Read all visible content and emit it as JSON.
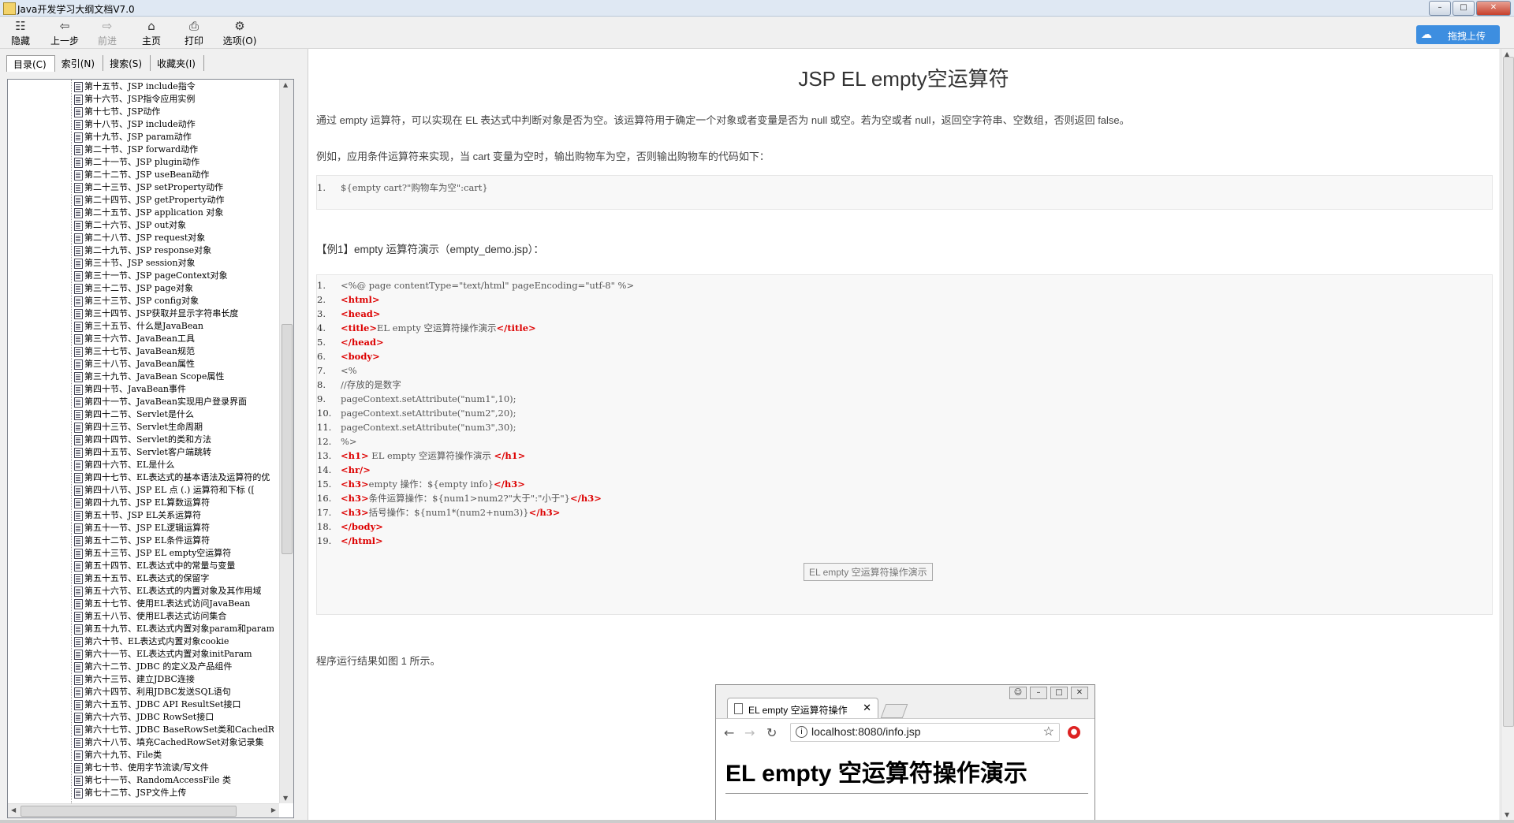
{
  "window": {
    "title": "Java开发学习大纲文档V7.0"
  },
  "toolbar": {
    "hide": "隐藏",
    "back": "上一步",
    "forward": "前进",
    "home": "主页",
    "print": "打印",
    "options": "选项(O)",
    "upload": "拖拽上传"
  },
  "tabs": [
    "目录(C)",
    "索引(N)",
    "搜索(S)",
    "收藏夹(I)"
  ],
  "tree": [
    "第十五节、JSP include指令",
    "第十六节、JSP指令应用实例",
    "第十七节、JSP动作",
    "第十八节、JSP include动作",
    "第十九节、JSP param动作",
    "第二十节、JSP forward动作",
    "第二十一节、JSP plugin动作",
    "第二十二节、JSP useBean动作",
    "第二十三节、JSP setProperty动作",
    "第二十四节、JSP getProperty动作",
    "第二十五节、JSP application 对象",
    "第二十六节、JSP out对象",
    "第二十八节、JSP request对象",
    "第二十九节、JSP response对象",
    "第三十节、JSP session对象",
    "第三十一节、JSP pageContext对象",
    "第三十二节、JSP page对象",
    "第三十三节、JSP config对象",
    "第三十四节、JSP获取并显示字符串长度",
    "第三十五节、什么是JavaBean",
    "第三十六节、JavaBean工具",
    "第三十七节、JavaBean规范",
    "第三十八节、JavaBean属性",
    "第三十九节、JavaBean Scope属性",
    "第四十节、JavaBean事件",
    "第四十一节、JavaBean实现用户登录界面",
    "第四十二节、Servlet是什么",
    "第四十三节、Servlet生命周期",
    "第四十四节、Servlet的类和方法",
    "第四十五节、Servlet客户端跳转",
    "第四十六节、EL是什么",
    "第四十七节、EL表达式的基本语法及运算符的优",
    "第四十八节、JSP EL 点 (.) 运算符和下标 ([",
    "第四十九节、JSP EL算数运算符",
    "第五十节、JSP EL关系运算符",
    "第五十一节、JSP EL逻辑运算符",
    "第五十二节、JSP EL条件运算符",
    "第五十三节、JSP EL empty空运算符",
    "第五十四节、EL表达式中的常量与变量",
    "第五十五节、EL表达式的保留字",
    "第五十六节、EL表达式的内置对象及其作用域",
    "第五十七节、使用EL表达式访问JavaBean",
    "第五十八节、使用EL表达式访问集合",
    "第五十九节、EL表达式内置对象param和paramV",
    "第六十节、EL表达式内置对象cookie",
    "第六十一节、EL表达式内置对象initParam",
    "第六十二节、JDBC 的定义及产品组件",
    "第六十三节、建立JDBC连接",
    "第六十四节、利用JDBC发送SQL语句",
    "第六十五节、JDBC API ResultSet接口",
    "第六十六节、JDBC RowSet接口",
    "第六十七节、JDBC BaseRowSet类和CachedRowS",
    "第六十八节、填充CachedRowSet对象记录集",
    "第六十九节、File类",
    "第七十节、使用字节流读/写文件",
    "第七十一节、RandomAccessFile 类",
    "第七十二节、JSP文件上传"
  ],
  "content": {
    "title": "JSP EL empty空运算符",
    "p1": "通过 empty 运算符，可以实现在 EL 表达式中判断对象是否为空。该运算符用于确定一个对象或者变量是否为 null 或空。若为空或者 null，返回空字符串、空数组，否则返回 false。",
    "p2": "例如，应用条件运算符来实现，当 cart 变量为空时，输出购物车为空，否则输出购物车的代码如下：",
    "code1": [
      {
        "n": "1.",
        "text": "${empty cart?\"购物车为空\":cart}"
      }
    ],
    "example_heading": "【例1】empty 运算符演示（empty_demo.jsp）：",
    "code2": [
      {
        "n": "1.",
        "text": "<%@ page contentType=\"text/html\"  pageEncoding=\"utf-8\" %>"
      },
      {
        "n": "2.",
        "tag": "<html>"
      },
      {
        "n": "3.",
        "tag": "<head>"
      },
      {
        "n": "4.",
        "tag": "<title>",
        "text": "EL empty 空运算符操作演示",
        "tag2": "</title>"
      },
      {
        "n": "5.",
        "tag": "</head>"
      },
      {
        "n": "6.",
        "tag": "<body>"
      },
      {
        "n": "7.",
        "text": "<%"
      },
      {
        "n": "8.",
        "text": "//存放的是数字"
      },
      {
        "n": "9.",
        "text": "pageContext.setAttribute(\"num1\",10);"
      },
      {
        "n": "10.",
        "text": "pageContext.setAttribute(\"num2\",20);"
      },
      {
        "n": "11.",
        "text": "pageContext.setAttribute(\"num3\",30);"
      },
      {
        "n": "12.",
        "text": "%>"
      },
      {
        "n": "13.",
        "tag": "<h1>",
        "text": " EL empty 空运算符操作演示 ",
        "tag2": "</h1>"
      },
      {
        "n": "14.",
        "tag": "<hr/>"
      },
      {
        "n": "15.",
        "tag": "<h3>",
        "text": "empty 操作：${empty info}",
        "tag2": "</h3>"
      },
      {
        "n": "16.",
        "tag": "<h3>",
        "text": "条件运算操作：${num1>num2?\"大于\":\"小于\"}",
        "tag2": "</h3>"
      },
      {
        "n": "17.",
        "tag": "<h3>",
        "text": "括号操作：${num1*(num2+num3)}",
        "tag2": "</h3>"
      },
      {
        "n": "18.",
        "tag": "</body>"
      },
      {
        "n": "19.",
        "tag": "</html>"
      }
    ],
    "tooltip": "EL empty 空运算符操作演示",
    "p3": "程序运行结果如图 1 所示。",
    "browser": {
      "tab_title": "EL empty 空运算符操作",
      "url": "localhost:8080/info.jsp",
      "heading": "EL empty 空运算符操作演示"
    }
  }
}
